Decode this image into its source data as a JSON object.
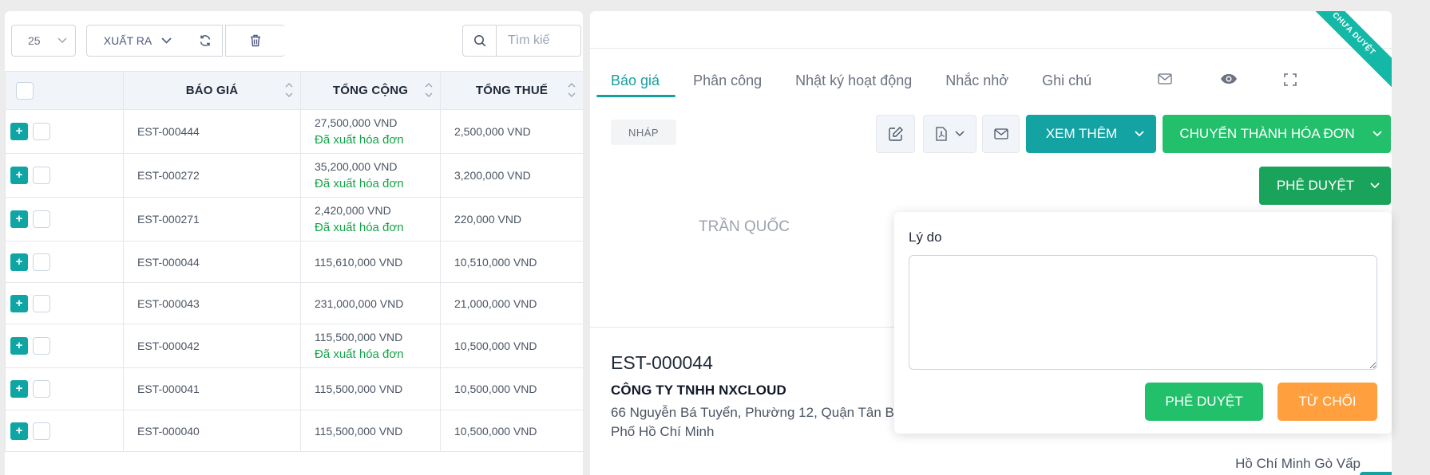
{
  "list": {
    "page_size": "25",
    "export_label": "XUẤT RA",
    "search_placeholder": "Tìm kiế",
    "columns": [
      "BÁO GIÁ",
      "TỔNG CỘNG",
      "TỔNG THUẾ"
    ],
    "rows": [
      {
        "code": "EST-000444",
        "total": "27,500,000 VND",
        "status": "Đã xuất hóa đơn",
        "tax": "2,500,000 VND"
      },
      {
        "code": "EST-000272",
        "total": "35,200,000 VND",
        "status": "Đã xuất hóa đơn",
        "tax": "3,200,000 VND"
      },
      {
        "code": "EST-000271",
        "total": "2,420,000 VND",
        "status": "Đã xuất hóa đơn",
        "tax": "220,000 VND"
      },
      {
        "code": "EST-000044",
        "total": "115,610,000 VND",
        "status": "",
        "tax": "10,510,000 VND"
      },
      {
        "code": "EST-000043",
        "total": "231,000,000 VND",
        "status": "",
        "tax": "21,000,000 VND"
      },
      {
        "code": "EST-000042",
        "total": "115,500,000 VND",
        "status": "Đã xuất hóa đơn",
        "tax": "10,500,000 VND"
      },
      {
        "code": "EST-000041",
        "total": "115,500,000 VND",
        "status": "",
        "tax": "10,500,000 VND"
      },
      {
        "code": "EST-000040",
        "total": "115,500,000 VND",
        "status": "",
        "tax": "10,500,000 VND"
      }
    ]
  },
  "detail": {
    "ribbon": "CHƯA DUYỆT",
    "tabs": [
      "Báo giá",
      "Phân công",
      "Nhật ký hoạt động",
      "Nhắc nhở",
      "Ghi chú"
    ],
    "status": "NHÁP",
    "more_label": "XEM THÊM",
    "convert_label": "CHUYỂN THÀNH HÓA ĐƠN",
    "approve_menu_label": "PHÊ DUYỆT",
    "client_name": "TRẦN QUỐC",
    "estimate_number": "EST-000044",
    "company_name": "CÔNG TY TNHH NXCLOUD",
    "address_line1": "66 Nguyễn Bá Tuyển, Phường 12, Quận Tân B",
    "address_line2": "Phố Hồ Chí Minh",
    "ship_location": "Hồ Chí Minh Gò Vấp"
  },
  "approval": {
    "reason_label": "Lý do",
    "approve_label": "PHÊ DUYỆT",
    "reject_label": "TỪ CHỐI"
  },
  "colors": {
    "teal": "#14a3a3",
    "green": "#22c06b",
    "orange": "#ff9f3d",
    "invoiced_text": "#16a34a"
  }
}
